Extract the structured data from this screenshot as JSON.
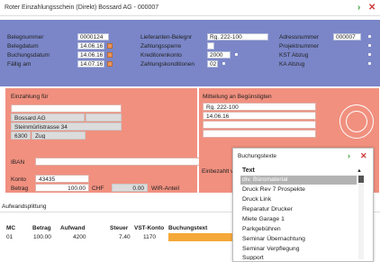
{
  "window": {
    "title": "Roter Einzahlungsschein (Direkt) Bossard AG - 000007"
  },
  "header": {
    "belegnummer_label": "Belegnummer",
    "belegnummer": "0000124",
    "belegdatum_label": "Belegdatum",
    "belegdatum": "14.06.16",
    "buchungsdatum_label": "Buchungsdatum",
    "buchungsdatum": "14.06.16",
    "faellig_label": "Fällig am",
    "faellig": "14.07.16",
    "lieferanten_label": "Lieferanten-Belegnr",
    "lieferanten": "Rg. 222-100",
    "zahlungssperre_label": "Zahlungssperre",
    "kreditorenkonto_label": "Kreditorenkonto",
    "kreditorenkonto": "2000",
    "zahlungskonditionen_label": "Zahlungskonditionen",
    "zahlungskonditionen": "02",
    "adressnummer_label": "Adressnummer",
    "adressnummer": "000007",
    "projektnummer_label": "Projektnummer",
    "kst_label": "KST Abzug",
    "ka_label": "KA Abzug"
  },
  "einzahlung": {
    "label": "Einzahlung für",
    "name": "Bossard AG",
    "street": "Steinmürlistrasse 34",
    "plz": "6300",
    "city": "Zug"
  },
  "mitteilung": {
    "label": "Mitteilung an Begünstigten",
    "line1": "Rg. 222-100",
    "line2": "14.06.16"
  },
  "iban_label": "IBAN",
  "konto_label": "Konto",
  "konto": "43435",
  "betrag_label": "Betrag",
  "betrag": "100.00",
  "chf": "CHF",
  "wir_amount": "0.00",
  "wir_label": "WIR-Anteil",
  "einbezahlt_label": "Einbezahlt v",
  "aufwand": {
    "title": "Aufwandsplittung",
    "columns": [
      "MC",
      "Betrag",
      "Aufwand",
      "Steuer",
      "VST-Konto",
      "Buchungstext"
    ],
    "rows": [
      [
        "01",
        "100.00",
        "4200",
        "7.40",
        "1170",
        ""
      ]
    ]
  },
  "popup": {
    "title": "Buchungstexte",
    "column": "Text",
    "items": [
      "div. Büromaterial",
      "Druck Rev 7 Prospekte",
      "Druck Link",
      "Reparatur Drucker",
      "Miete Garage 1",
      "Parkgebühren",
      "Seminar Übernachtung",
      "Seminar Verpflegung",
      "Support"
    ],
    "selected_index": 0
  },
  "colors": {
    "header": "#7a86c8",
    "pink": "#f1907f",
    "highlight": "#f5a83a",
    "ok": "#3aa33a",
    "close": "#d03a3a"
  }
}
